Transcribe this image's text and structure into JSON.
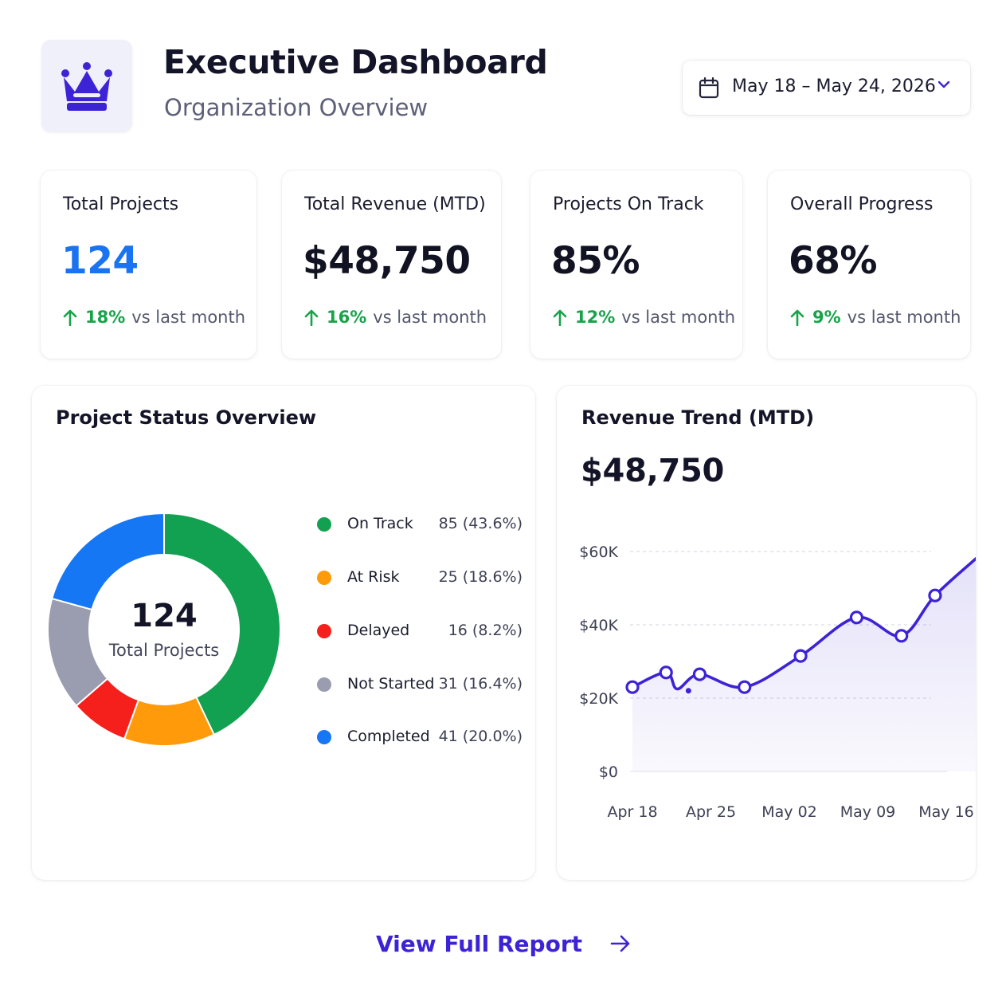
{
  "header": {
    "title": "Executive Dashboard",
    "subtitle": "Organization Overview",
    "logo_icon": "crown-icon",
    "date_range": "May 18 – May 24, 2026"
  },
  "kpis": [
    {
      "label": "Total Projects",
      "value": "124",
      "change": "18%",
      "change_suffix": "vs last month",
      "value_color": "#1a73f0"
    },
    {
      "label": "Total Revenue (MTD)",
      "value": "$48,750",
      "change": "16%",
      "change_suffix": "vs last month"
    },
    {
      "label": "Projects On Track",
      "value": "85%",
      "change": "12%",
      "change_suffix": "vs last month"
    },
    {
      "label": "Overall Progress",
      "value": "68%",
      "change": "9%",
      "change_suffix": "vs last month"
    }
  ],
  "status_panel": {
    "title": "Project Status Overview",
    "center_value": "124",
    "center_label": "Total Projects"
  },
  "revenue_panel": {
    "title": "Revenue Trend (MTD)",
    "value": "$48,750"
  },
  "chart_data": [
    {
      "type": "pie",
      "donut": true,
      "categories": [
        "On Track",
        "At Risk",
        "Delayed",
        "Not Started",
        "Completed"
      ],
      "values": [
        85,
        25,
        16,
        31,
        41
      ],
      "value_labels": [
        "85 (43.6%)",
        "25 (18.6%)",
        "16 (8.2%)",
        "31 (16.4%)",
        "41 (20.0%)"
      ],
      "colors": [
        "#12a150",
        "#ff9a0a",
        "#f5201c",
        "#9a9caf",
        "#1677f5"
      ],
      "legend": "right"
    },
    {
      "type": "area",
      "x": [
        "Apr 18",
        "Apr 21",
        "Apr 24",
        "Apr 27",
        "May 04",
        "May 08",
        "May 12",
        "May 17"
      ],
      "extra_points": [
        {
          "x": "Apr 21",
          "y": 26500
        },
        {
          "x": "Apr 23",
          "y": 22000
        },
        {
          "x": "Apr 24",
          "y": 25500
        }
      ],
      "series": [
        {
          "points": [
            {
              "x": "Apr 18",
              "y": 23000
            },
            {
              "x": "Apr 21",
              "y": 27000
            },
            {
              "x": "Apr 22",
              "y": 22500
            },
            {
              "x": "Apr 24",
              "y": 26500
            },
            {
              "x": "Apr 28",
              "y": 23000
            },
            {
              "x": "May 03",
              "y": 31500
            },
            {
              "x": "May 08",
              "y": 42000
            },
            {
              "x": "May 12",
              "y": 37000
            },
            {
              "x": "May 15",
              "y": 48000
            },
            {
              "x": "May 19",
              "y": 59000
            }
          ],
          "color": "#3d23d6"
        }
      ],
      "xticks": [
        "Apr 18",
        "Apr 25",
        "May 02",
        "May 09",
        "May 16"
      ],
      "yticks": [
        "$0",
        "$20K",
        "$40K",
        "$60K"
      ],
      "ylim": [
        0,
        60000
      ],
      "grid": true
    }
  ],
  "footer": {
    "cta_label": "View Full Report"
  }
}
